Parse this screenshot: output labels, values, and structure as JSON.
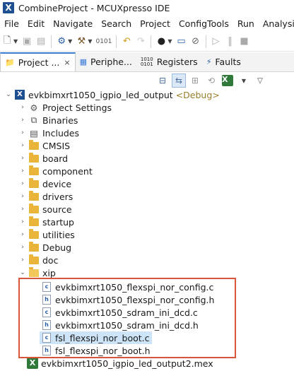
{
  "window": {
    "title": "CombineProject - MCUXpresso IDE"
  },
  "menu": [
    "File",
    "Edit",
    "Navigate",
    "Search",
    "Project",
    "ConfigTools",
    "Run",
    "Analysis"
  ],
  "tabs": [
    {
      "label": "Project ...",
      "icon": "project-explorer-icon",
      "active": true,
      "close": "×"
    },
    {
      "label": "Periphe...",
      "icon": "peripherals-icon"
    },
    {
      "label": "Registers",
      "icon": "registers-icon"
    },
    {
      "label": "Faults",
      "icon": "faults-icon"
    }
  ],
  "tree": {
    "project": {
      "name": "evkbimxrt1050_igpio_led_output",
      "config": "<Debug>"
    },
    "items": [
      {
        "label": "Project Settings",
        "icon": "settings-icon"
      },
      {
        "label": "Binaries",
        "icon": "binaries-icon"
      },
      {
        "label": "Includes",
        "icon": "includes-icon"
      },
      {
        "label": "CMSIS",
        "icon": "folder-icon"
      },
      {
        "label": "board",
        "icon": "folder-icon"
      },
      {
        "label": "component",
        "icon": "folder-icon"
      },
      {
        "label": "device",
        "icon": "folder-icon"
      },
      {
        "label": "drivers",
        "icon": "folder-icon"
      },
      {
        "label": "source",
        "icon": "folder-icon"
      },
      {
        "label": "startup",
        "icon": "folder-icon"
      },
      {
        "label": "utilities",
        "icon": "folder-icon"
      },
      {
        "label": "Debug",
        "icon": "folder-icon"
      },
      {
        "label": "doc",
        "icon": "folder-icon"
      },
      {
        "label": "xip",
        "icon": "folder-open-icon"
      }
    ],
    "xip_files": [
      {
        "label": "evkbimxrt1050_flexspi_nor_config.c",
        "type": "c"
      },
      {
        "label": "evkbimxrt1050_flexspi_nor_config.h",
        "type": "h"
      },
      {
        "label": "evkbimxrt1050_sdram_ini_dcd.c",
        "type": "c"
      },
      {
        "label": "evkbimxrt1050_sdram_ini_dcd.h",
        "type": "h"
      },
      {
        "label": "fsl_flexspi_nor_boot.c",
        "type": "c",
        "selected": true
      },
      {
        "label": "fsl_flexspi_nor_boot.h",
        "type": "h"
      }
    ],
    "mex_file": "evkbimxrt1050_igpio_led_output2.mex"
  },
  "colors": {
    "highlight_box": "#d9553a",
    "selection": "#cde3f7",
    "active_tab_accent": "#3a7bd5"
  }
}
